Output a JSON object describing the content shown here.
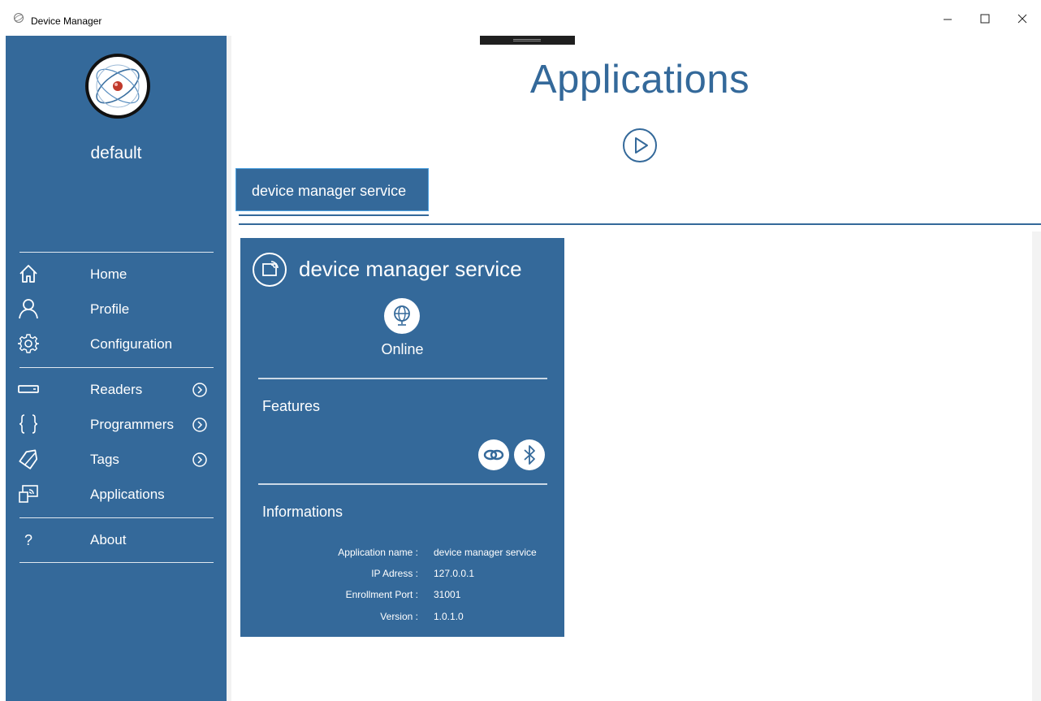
{
  "window": {
    "title": "Device Manager",
    "controls": {
      "minimize": "–",
      "maximize": "☐",
      "close": "✕"
    }
  },
  "sidebar": {
    "username": "default",
    "items": [
      {
        "label": "Home",
        "icon": "home-icon"
      },
      {
        "label": "Profile",
        "icon": "person-icon"
      },
      {
        "label": "Configuration",
        "icon": "gear-icon"
      },
      {
        "label": "Readers",
        "icon": "reader-icon",
        "expandable": true
      },
      {
        "label": "Programmers",
        "icon": "braces-icon",
        "expandable": true
      },
      {
        "label": "Tags",
        "icon": "tag-icon",
        "expandable": true
      },
      {
        "label": "Applications",
        "icon": "cast-icon"
      },
      {
        "label": "About",
        "icon": "question-icon"
      }
    ]
  },
  "main": {
    "title": "Applications",
    "tabs": [
      {
        "label": "device manager service",
        "active": true
      }
    ],
    "card": {
      "title": "device manager service",
      "status": "Online",
      "features_title": "Features",
      "features": [
        "link-icon",
        "bluetooth-icon"
      ],
      "informations_title": "Informations",
      "info": [
        {
          "label": "Application name :",
          "value": "device manager service"
        },
        {
          "label": "IP Adress :",
          "value": "127.0.0.1"
        },
        {
          "label": "Enrollment Port :",
          "value": "31001"
        },
        {
          "label": "Version :",
          "value": "1.0.1.0"
        }
      ]
    }
  },
  "colors": {
    "primary": "#34699a",
    "tab_border": "#4aa0e0"
  }
}
